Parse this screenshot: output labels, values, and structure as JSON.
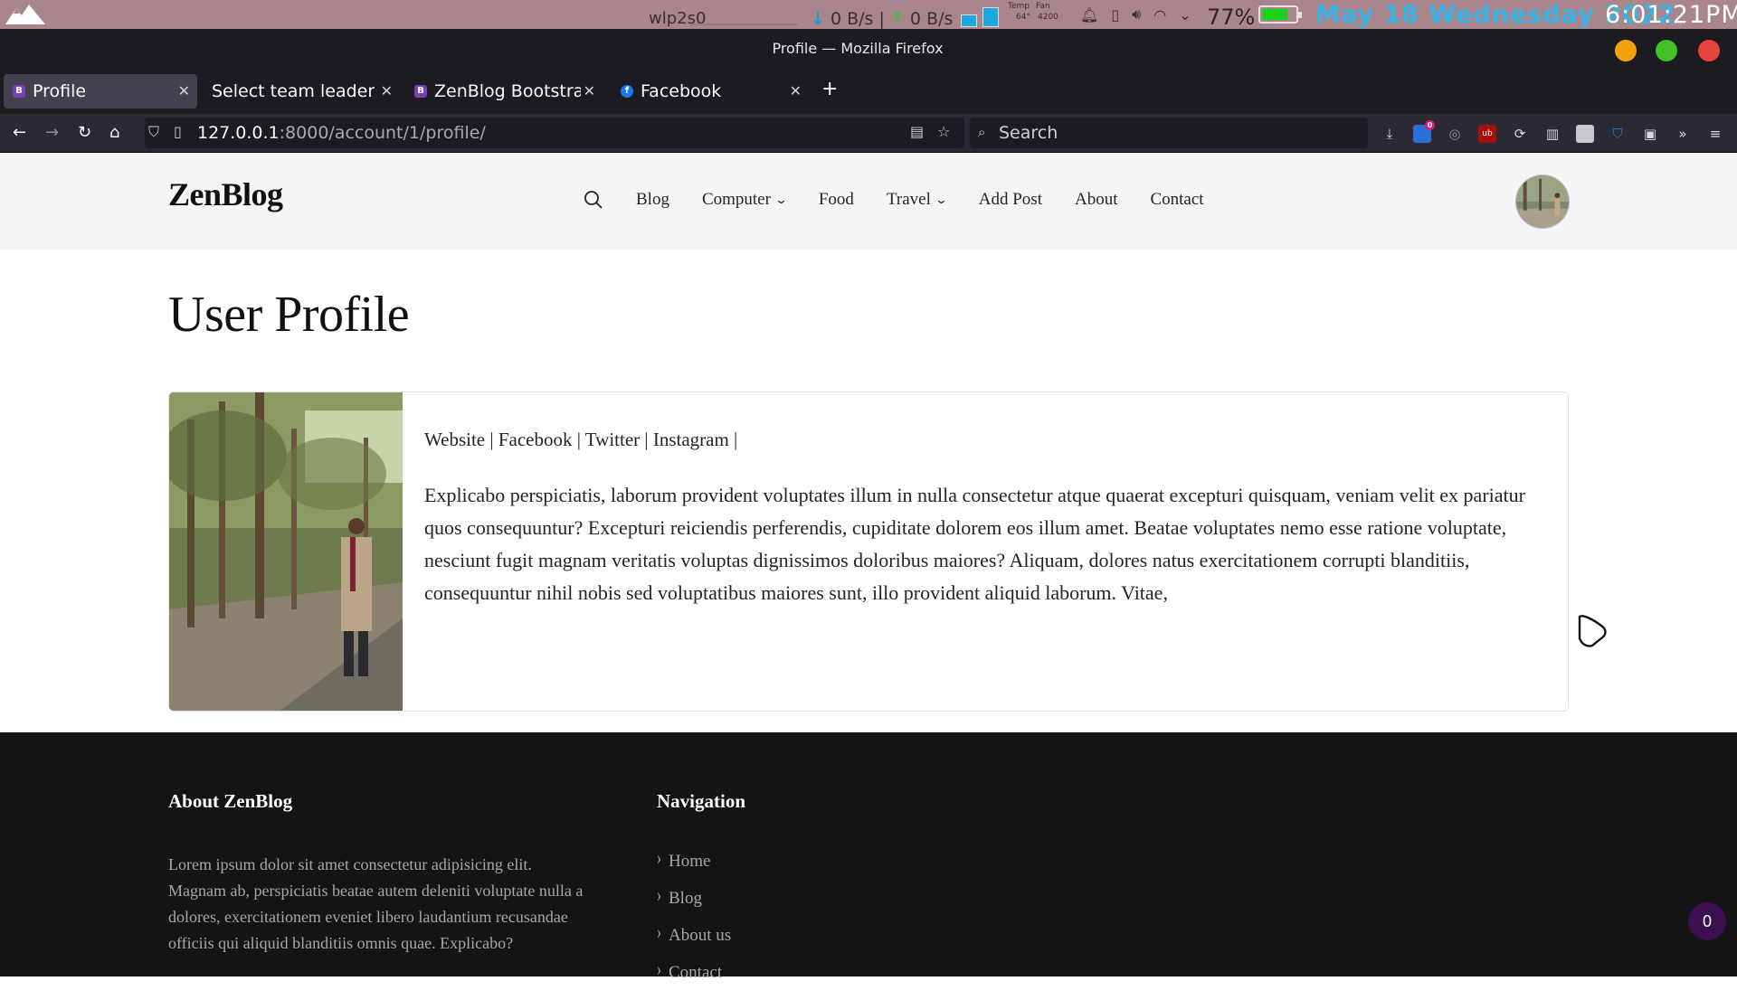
{
  "system_bar": {
    "network_name": "wlp2s0",
    "download": "0 B/s",
    "upload": "0 B/s",
    "temp_label": "Temp",
    "temp_value": "64°",
    "fan_label": "Fan",
    "fan_value": "4200",
    "battery_percent": "77%",
    "battery_level": 0.77,
    "date": "May 18 Wednesday 2022",
    "time": "6:01:21PM",
    "date_color": "#38b3e6"
  },
  "window": {
    "title": "Profile — Mozilla Firefox",
    "controls": {
      "minimize_color": "#f0a30a",
      "maximize_color": "#42c025",
      "close_color": "#e8453c"
    }
  },
  "tabs": [
    {
      "label": "Profile",
      "favicon": "B",
      "active": true
    },
    {
      "label": "Select team leader to",
      "favicon": "",
      "active": false
    },
    {
      "label": "ZenBlog Bootstrap",
      "favicon": "B",
      "active": false
    },
    {
      "label": "Facebook",
      "favicon": "f",
      "active": false
    }
  ],
  "navbar": {
    "url_host": "127.0.0.1",
    "url_rest": ":8000/account/1/profile/",
    "search_placeholder": "Search",
    "extension_badge": "0"
  },
  "site": {
    "brand": "ZenBlog",
    "menu": [
      "Blog",
      "Computer",
      "Food",
      "Travel",
      "Add Post",
      "About",
      "Contact"
    ],
    "page_title": "User Profile",
    "profile": {
      "links": "Website | Facebook | Twitter | Instagram |",
      "bio": "Explicabo perspiciatis, laborum provident voluptates illum in nulla consectetur atque quaerat excepturi quisquam, veniam velit ex pariatur quos consequuntur? Excepturi reiciendis perferendis, cupiditate dolorem eos illum amet. Beatae voluptates nemo esse ratione voluptate, nesciunt fugit magnam veritatis voluptas dignissimos doloribus maiores? Aliquam, dolores natus exercitationem corrupti blanditiis, consequuntur nihil nobis sed voluptatibus maiores sunt, illo provident aliquid laborum. Vitae,"
    },
    "footer": {
      "about_heading": "About ZenBlog",
      "about_text": "Lorem ipsum dolor sit amet consectetur adipisicing elit. Magnam ab, perspiciatis beatae autem deleniti voluptate nulla a dolores, exercitationem eveniet libero laudantium recusandae officiis qui aliquid blanditiis omnis quae. Explicabo?",
      "nav_heading": "Navigation",
      "nav_items": [
        "Home",
        "Blog",
        "About us",
        "Contact"
      ]
    },
    "badge_count": "0"
  }
}
